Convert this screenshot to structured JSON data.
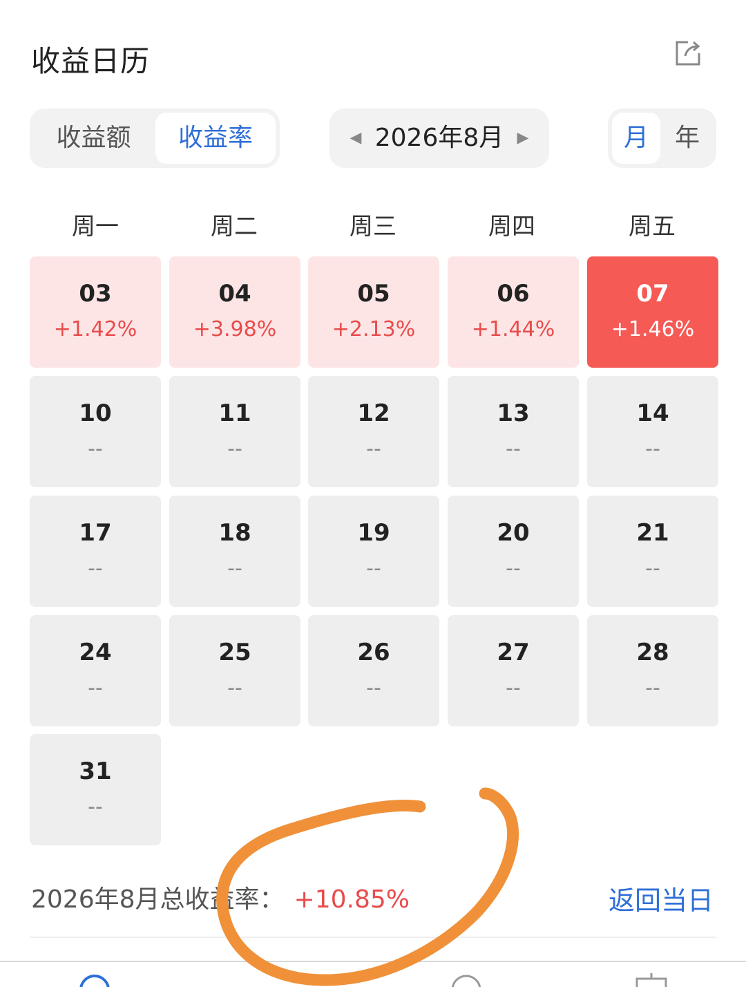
{
  "header": {
    "title": "收益日历",
    "share_icon": "share-icon"
  },
  "segment_type": {
    "amount_label": "收益额",
    "rate_label": "收益率",
    "selected": "收益率"
  },
  "month_picker": {
    "label": "2026年8月",
    "prev_icon": "triangle-left-icon",
    "next_icon": "triangle-right-icon"
  },
  "period_toggle": {
    "month_label": "月",
    "year_label": "年",
    "selected": "月"
  },
  "weekdays": [
    "周一",
    "周二",
    "周三",
    "周四",
    "周五"
  ],
  "calendar": {
    "weeks": [
      [
        {
          "day": "03",
          "value": "+1.42%",
          "state": "pos"
        },
        {
          "day": "04",
          "value": "+3.98%",
          "state": "pos"
        },
        {
          "day": "05",
          "value": "+2.13%",
          "state": "pos"
        },
        {
          "day": "06",
          "value": "+1.44%",
          "state": "pos"
        },
        {
          "day": "07",
          "value": "+1.46%",
          "state": "today"
        }
      ],
      [
        {
          "day": "10",
          "value": "--",
          "state": "none"
        },
        {
          "day": "11",
          "value": "--",
          "state": "none"
        },
        {
          "day": "12",
          "value": "--",
          "state": "none"
        },
        {
          "day": "13",
          "value": "--",
          "state": "none"
        },
        {
          "day": "14",
          "value": "--",
          "state": "none"
        }
      ],
      [
        {
          "day": "17",
          "value": "--",
          "state": "none"
        },
        {
          "day": "18",
          "value": "--",
          "state": "none"
        },
        {
          "day": "19",
          "value": "--",
          "state": "none"
        },
        {
          "day": "20",
          "value": "--",
          "state": "none"
        },
        {
          "day": "21",
          "value": "--",
          "state": "none"
        }
      ],
      [
        {
          "day": "24",
          "value": "--",
          "state": "none"
        },
        {
          "day": "25",
          "value": "--",
          "state": "none"
        },
        {
          "day": "26",
          "value": "--",
          "state": "none"
        },
        {
          "day": "27",
          "value": "--",
          "state": "none"
        },
        {
          "day": "28",
          "value": "--",
          "state": "none"
        }
      ],
      [
        {
          "day": "31",
          "value": "--",
          "state": "none"
        }
      ]
    ]
  },
  "summary": {
    "label": "2026年8月总收益率：",
    "total": "+10.85%",
    "back_today": "返回当日"
  },
  "colors": {
    "accent_blue": "#2f6fd8",
    "gain_red": "#e84c4c",
    "today_red": "#f55a55",
    "gain_cell_bg": "#fde5e5",
    "empty_cell_bg": "#eeeeee",
    "annotation_orange": "#f0913a"
  }
}
